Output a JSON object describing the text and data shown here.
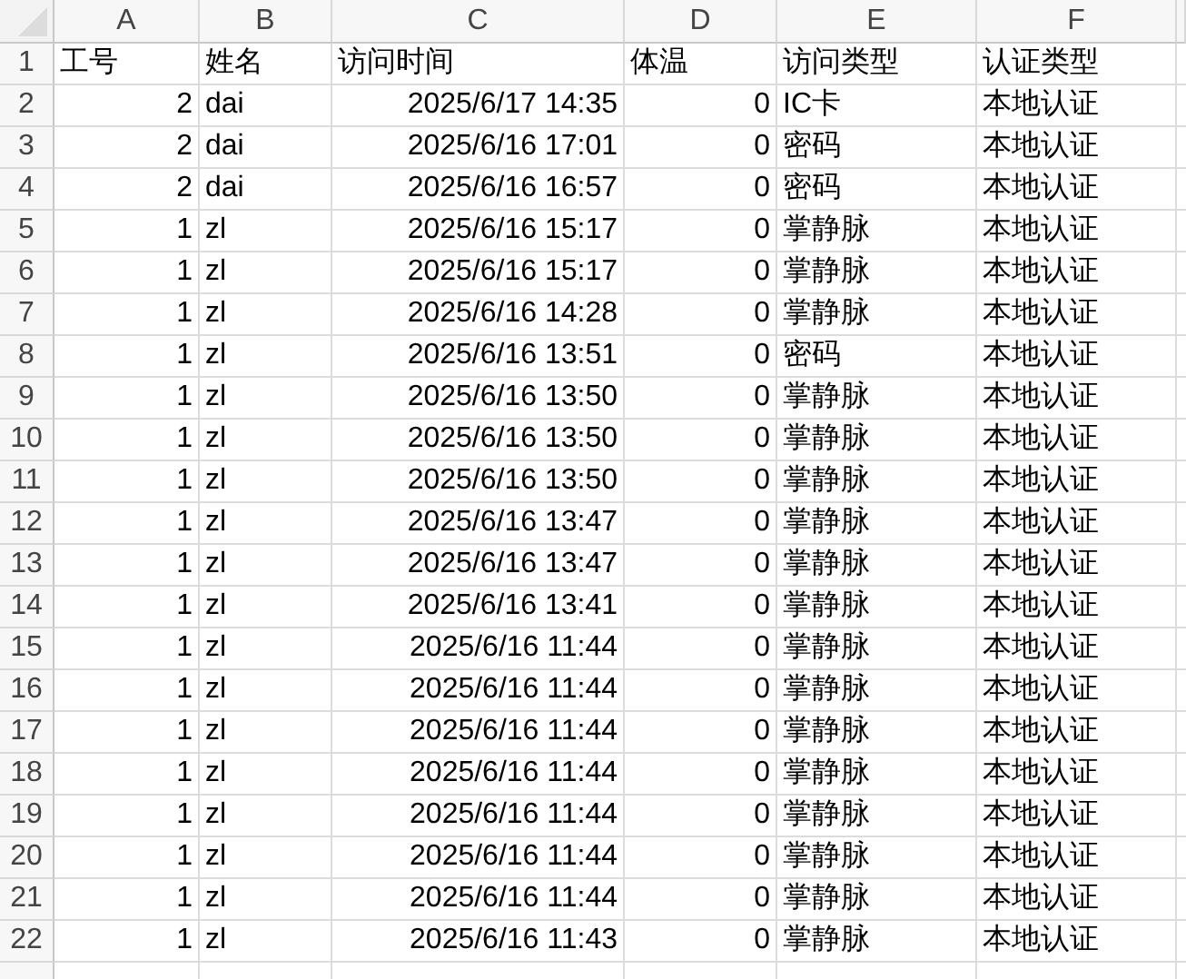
{
  "column_headers": [
    "A",
    "B",
    "C",
    "D",
    "E",
    "F"
  ],
  "rows": [
    {
      "number": "1",
      "cells": [
        "工号",
        "姓名",
        "访问时间",
        "体温",
        "访问类型",
        "认证类型"
      ]
    },
    {
      "number": "2",
      "cells": [
        "2",
        "dai",
        "2025/6/17 14:35",
        "0",
        "IC卡",
        "本地认证"
      ]
    },
    {
      "number": "3",
      "cells": [
        "2",
        "dai",
        "2025/6/16 17:01",
        "0",
        "密码",
        "本地认证"
      ]
    },
    {
      "number": "4",
      "cells": [
        "2",
        "dai",
        "2025/6/16 16:57",
        "0",
        "密码",
        "本地认证"
      ]
    },
    {
      "number": "5",
      "cells": [
        "1",
        "zl",
        "2025/6/16 15:17",
        "0",
        "掌静脉",
        "本地认证"
      ]
    },
    {
      "number": "6",
      "cells": [
        "1",
        "zl",
        "2025/6/16 15:17",
        "0",
        "掌静脉",
        "本地认证"
      ]
    },
    {
      "number": "7",
      "cells": [
        "1",
        "zl",
        "2025/6/16 14:28",
        "0",
        "掌静脉",
        "本地认证"
      ]
    },
    {
      "number": "8",
      "cells": [
        "1",
        "zl",
        "2025/6/16 13:51",
        "0",
        "密码",
        "本地认证"
      ]
    },
    {
      "number": "9",
      "cells": [
        "1",
        "zl",
        "2025/6/16 13:50",
        "0",
        "掌静脉",
        "本地认证"
      ]
    },
    {
      "number": "10",
      "cells": [
        "1",
        "zl",
        "2025/6/16 13:50",
        "0",
        "掌静脉",
        "本地认证"
      ]
    },
    {
      "number": "11",
      "cells": [
        "1",
        "zl",
        "2025/6/16 13:50",
        "0",
        "掌静脉",
        "本地认证"
      ]
    },
    {
      "number": "12",
      "cells": [
        "1",
        "zl",
        "2025/6/16 13:47",
        "0",
        "掌静脉",
        "本地认证"
      ]
    },
    {
      "number": "13",
      "cells": [
        "1",
        "zl",
        "2025/6/16 13:47",
        "0",
        "掌静脉",
        "本地认证"
      ]
    },
    {
      "number": "14",
      "cells": [
        "1",
        "zl",
        "2025/6/16 13:41",
        "0",
        "掌静脉",
        "本地认证"
      ]
    },
    {
      "number": "15",
      "cells": [
        "1",
        "zl",
        "2025/6/16 11:44",
        "0",
        "掌静脉",
        "本地认证"
      ]
    },
    {
      "number": "16",
      "cells": [
        "1",
        "zl",
        "2025/6/16 11:44",
        "0",
        "掌静脉",
        "本地认证"
      ]
    },
    {
      "number": "17",
      "cells": [
        "1",
        "zl",
        "2025/6/16 11:44",
        "0",
        "掌静脉",
        "本地认证"
      ]
    },
    {
      "number": "18",
      "cells": [
        "1",
        "zl",
        "2025/6/16 11:44",
        "0",
        "掌静脉",
        "本地认证"
      ]
    },
    {
      "number": "19",
      "cells": [
        "1",
        "zl",
        "2025/6/16 11:44",
        "0",
        "掌静脉",
        "本地认证"
      ]
    },
    {
      "number": "20",
      "cells": [
        "1",
        "zl",
        "2025/6/16 11:44",
        "0",
        "掌静脉",
        "本地认证"
      ]
    },
    {
      "number": "21",
      "cells": [
        "1",
        "zl",
        "2025/6/16 11:44",
        "0",
        "掌静脉",
        "本地认证"
      ]
    },
    {
      "number": "22",
      "cells": [
        "1",
        "zl",
        "2025/6/16 11:43",
        "0",
        "掌静脉",
        "本地认证"
      ]
    }
  ]
}
